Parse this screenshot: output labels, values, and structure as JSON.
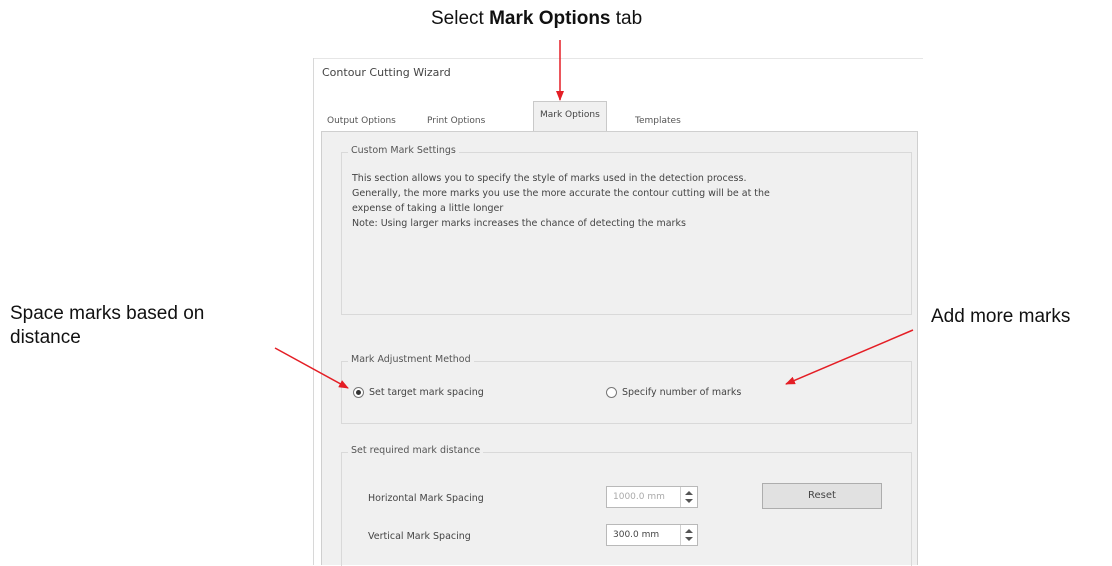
{
  "annotations": {
    "select_prefix": "Select ",
    "select_bold": "Mark Options",
    "select_suffix": " tab",
    "space_marks_line1": "Space marks based on",
    "space_marks_line2": "distance",
    "add_more_marks": "Add more marks",
    "arrow_color": "#e41e25"
  },
  "window": {
    "title": "Contour Cutting Wizard",
    "tabs": [
      {
        "label": "Output Options"
      },
      {
        "label": "Print Options"
      },
      {
        "label": "Mark Options",
        "active": true
      },
      {
        "label": "Templates"
      }
    ]
  },
  "custom_mark_settings": {
    "title": "Custom Mark Settings",
    "description": [
      "This section allows you to specify the style of marks used in the detection process.",
      "Generally, the more marks you use the more accurate the contour cutting will be at the",
      "expense of taking a little longer",
      "Note: Using larger marks increases the chance of detecting the marks"
    ]
  },
  "mark_adjustment": {
    "title": "Mark Adjustment Method",
    "option_spacing": "Set target mark spacing",
    "option_count": "Specify number of marks",
    "selected": "spacing"
  },
  "mark_distance": {
    "title": "Set required mark distance",
    "horizontal_label": "Horizontal Mark Spacing",
    "horizontal_value": "1000.0 mm",
    "vertical_label": "Vertical Mark Spacing",
    "vertical_value": "300.0 mm",
    "reset_label": "Reset"
  }
}
